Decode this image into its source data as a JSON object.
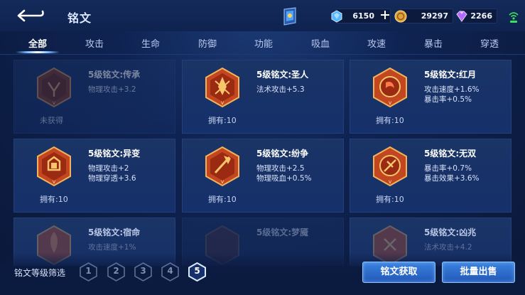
{
  "header": {
    "title": "铭文",
    "currencies": [
      {
        "name": "diamond-currency",
        "value": "6150"
      },
      {
        "name": "gold-currency",
        "value": "29297"
      },
      {
        "name": "crystal-currency",
        "value": "2266"
      }
    ]
  },
  "tabs": [
    {
      "label": "全部",
      "active": true
    },
    {
      "label": "攻击"
    },
    {
      "label": "生命"
    },
    {
      "label": "防御"
    },
    {
      "label": "功能"
    },
    {
      "label": "吸血"
    },
    {
      "label": "攻速"
    },
    {
      "label": "暴击"
    },
    {
      "label": "穿透"
    }
  ],
  "cards": [
    {
      "name": "5级铭文:传承",
      "stats": [
        "物理攻击+3.2",
        ""
      ],
      "owned": "未获得",
      "color": "#7c3a2a"
    },
    {
      "name": "5级铭文:圣人",
      "stats": [
        "法术攻击+5.3",
        ""
      ],
      "owned": "拥有:10",
      "color": "#c2461f"
    },
    {
      "name": "5级铭文:红月",
      "stats": [
        "攻击速度+1.6%",
        "暴击率+0.5%"
      ],
      "owned": "拥有:10",
      "color": "#c2461f"
    },
    {
      "name": "5级铭文:异变",
      "stats": [
        "物理攻击+2",
        "物理穿透+3.6"
      ],
      "owned": "拥有:10",
      "color": "#c2461f"
    },
    {
      "name": "5级铭文:纷争",
      "stats": [
        "物理攻击+2.5",
        "物理吸血+0.5%"
      ],
      "owned": "拥有:10",
      "color": "#c2461f"
    },
    {
      "name": "5级铭文:无双",
      "stats": [
        "暴击率+0.7%",
        "暴击效果+3.6%"
      ],
      "owned": "拥有:10",
      "color": "#c2461f"
    },
    {
      "name": "5级铭文:宿命",
      "stats": [
        "攻击速度+1%",
        ""
      ],
      "owned": "",
      "color": "#c2461f"
    },
    {
      "name": "5级铭文:梦魇",
      "stats": [
        "",
        ""
      ],
      "owned": "",
      "color": "#7c3a2a"
    },
    {
      "name": "5级铭文:凶兆",
      "stats": [
        "法术攻击+4.2",
        ""
      ],
      "owned": "",
      "color": "#c2461f"
    }
  ],
  "filter": {
    "label": "铭文等级筛选",
    "levels": [
      "1",
      "2",
      "3",
      "4",
      "5"
    ],
    "selected": "5"
  },
  "buttons": {
    "get": "铭文获取",
    "sell": "批量出售"
  },
  "colors": {
    "accent": "#3a82e0",
    "background": "#0f2352",
    "card": "#1a3466"
  }
}
